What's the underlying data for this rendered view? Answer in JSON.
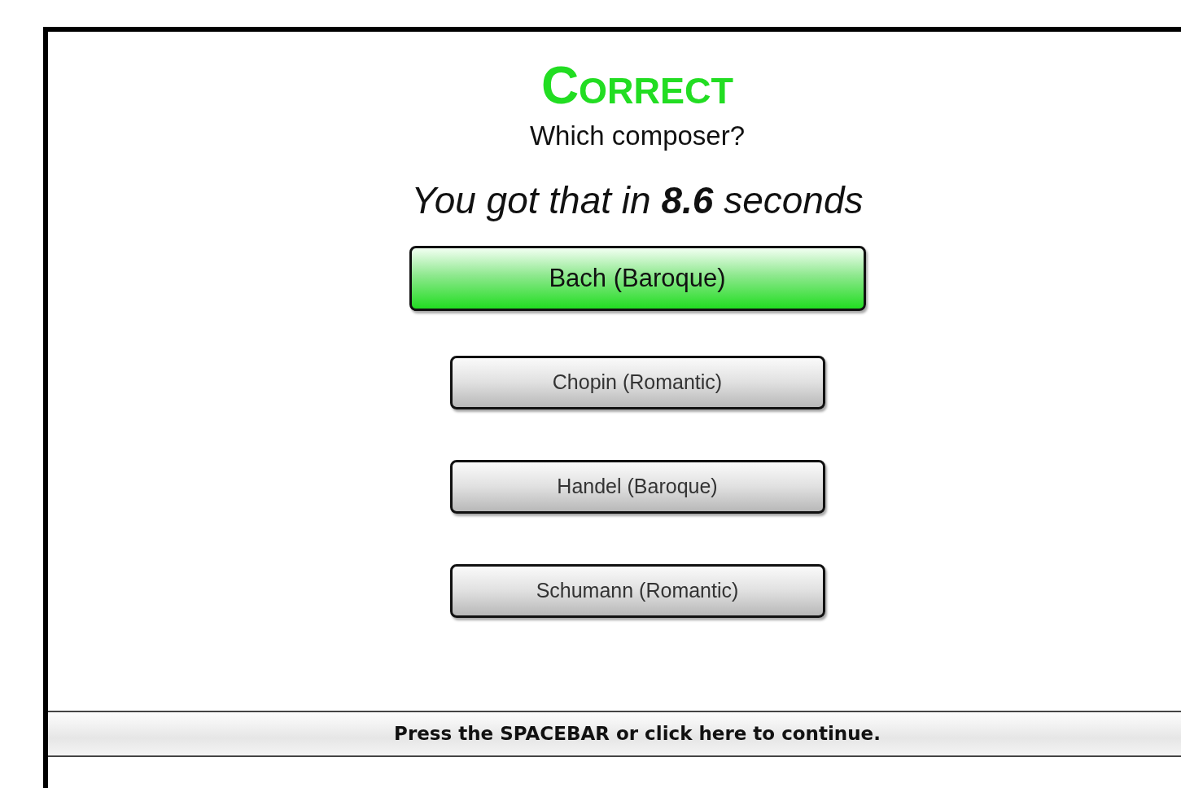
{
  "result": {
    "title": "Correct",
    "question": "Which composer?",
    "time_text": "You got that in **8.6** seconds"
  },
  "answers": [
    {
      "label": "Bach (Baroque)",
      "selected": true
    },
    {
      "label": "Chopin (Romantic)",
      "selected": false
    },
    {
      "label": "Handel (Baroque)",
      "selected": false
    },
    {
      "label": "Schumann (Romantic)",
      "selected": false
    }
  ],
  "continue_bar": {
    "label": "Press the SPACEBAR or click here to continue."
  }
}
